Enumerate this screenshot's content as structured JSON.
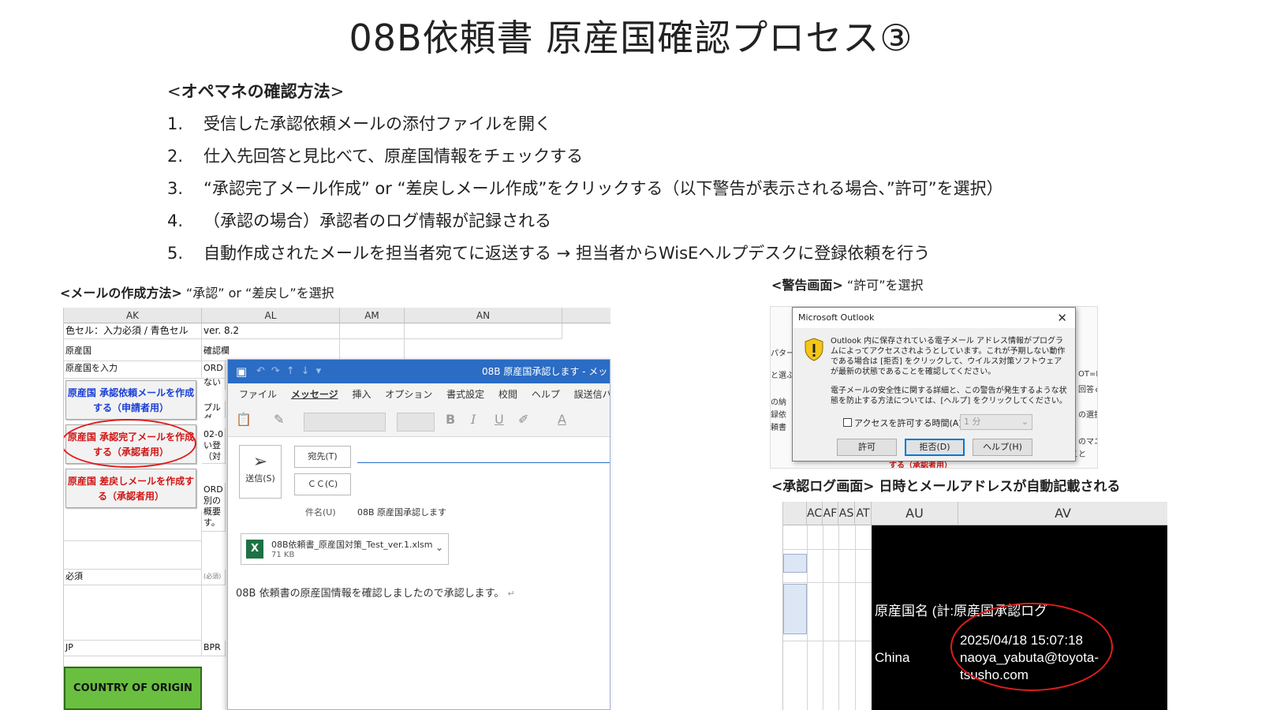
{
  "title": "08B依頼書 原産国確認プロセス③",
  "steps": {
    "heading_lt": "<",
    "heading": "オペマネの確認方法",
    "heading_gt": ">",
    "items": [
      {
        "num": "1.",
        "text": "受信した承認依頼メールの添付ファイルを開く"
      },
      {
        "num": "2.",
        "text": "仕入先回答と見比べて、原産国情報をチェックする"
      },
      {
        "num": "3.",
        "text": "“承認完了メール作成” or “差戻しメール作成”をクリックする（以下警告が表示される場合、”許可”を選択）"
      },
      {
        "num": "4.",
        "text": "（承認の場合）承認者のログ情報が記録される"
      },
      {
        "num": "5.",
        "text": "自動作成されたメールを担当者宛てに返送する → 担当者からWisEヘルプデスクに登録依頼を行う"
      }
    ]
  },
  "captions": {
    "mail": {
      "bold": "<メールの作成方法>",
      "rest": " “承認” or “差戻し”を選択"
    },
    "warning": {
      "bold": "<警告画面>",
      "rest": " “許可”を選択"
    },
    "log": {
      "bold": "<承認ログ画面> 日時とメールアドレスが自動記載される",
      "rest": ""
    }
  },
  "sheet": {
    "columns": [
      "AK",
      "AL",
      "AM",
      "AN"
    ],
    "row1_left": "色セル：入力必須 / 青色セル",
    "row1_right": "ver. 8.2",
    "origin_label": "原産国",
    "check_label": "確認欄",
    "origin_input": "原産国を入力",
    "col_al_snippets": [
      "ORD",
      "ない",
      "プルダ",
      "02-0",
      "い登",
      "（対",
      "ORD",
      "別の",
      "概要",
      "す。"
    ],
    "btn_request": "原産国 承認依頼メールを作成する（申請者用）",
    "btn_approve": "原産国 承認完了メールを作成する（承認者用）",
    "btn_reject": "原産国 差戻しメールを作成する（承認者用）",
    "required": "必須",
    "required_note": "(必須)",
    "jp": "JP",
    "bpr": "BPR",
    "coo": "COUNTRY OF ORIGIN"
  },
  "outlook": {
    "title": "08B 原産国承認します - メッ",
    "menu": [
      "ファイル",
      "メッセージ",
      "挿入",
      "オプション",
      "書式設定",
      "校閲",
      "ヘルプ",
      "誤送信バ"
    ],
    "send": "送信(S)",
    "to": "宛先(T)",
    "cc": "ＣＣ(C)",
    "subject_label": "件名(U)",
    "subject": "08B 原産国承認します",
    "attachment_name": "08B依頼書_原産国対策_Test_ver.1.xlsm",
    "attachment_size": "71 KB",
    "body": "08B 依頼書の原産国情報を確認しましたので承認します。"
  },
  "warning": {
    "dialog_title": "Microsoft Outlook",
    "message1": "Outlook 内に保存されている電子メール アドレス情報がプログラムによってアクセスされようとしています。これが予期しない動作である場合は [拒否] をクリックして、ウイルス対策ソフトウェアが最新の状態であることを確認してください。",
    "message2": "電子メールの安全性に関する詳細と、この警告が発生するような状態を防止する方法については、[ヘルプ] をクリックしてください。",
    "checkbox": "アクセスを許可する時間(A):",
    "duration": "1 分",
    "allow": "許可",
    "deny": "拒否(D)",
    "help": "ヘルプ(H)",
    "bg_left": [
      "パター",
      "と選ぶ",
      "の納",
      "録依",
      "頼書"
    ],
    "bg_right": [
      "OT=D",
      "回答ｏ",
      "の選択",
      "のマニ",
      "登録をすること"
    ],
    "bg_under": "する（承認者用）"
  },
  "log": {
    "columns": [
      "AC",
      "AF",
      "AS",
      "AT",
      "AU",
      "AV"
    ],
    "label": "原産国名 (計:原産国承認ログ",
    "country": "China",
    "datetime": "2025/04/18 15:07:18",
    "email1": "naoya_yabuta@toyota-",
    "email2": "tsusho.com"
  }
}
